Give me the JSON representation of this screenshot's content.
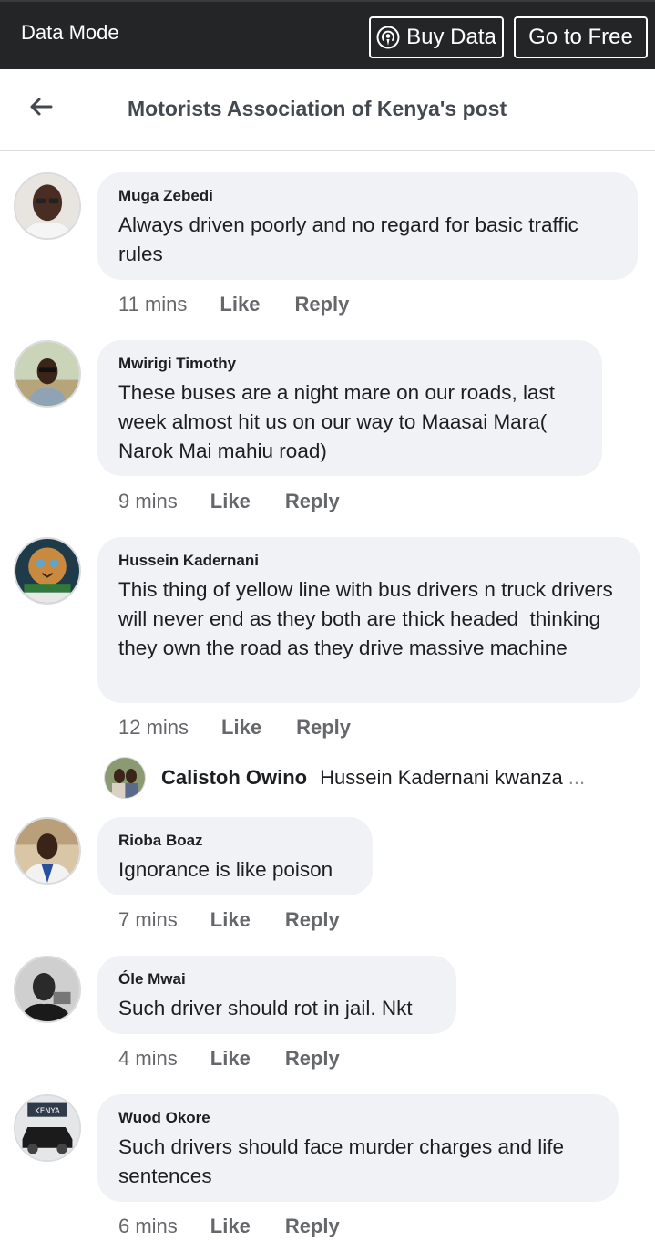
{
  "topbar": {
    "mode": "Data Mode",
    "buy_label": "Buy Data",
    "buy_icon": "podcast-icon",
    "free_label": "Go to Free"
  },
  "header": {
    "back_icon": "arrow-left-icon",
    "title": "Motorists Association of Kenya's post"
  },
  "comments": [
    {
      "author": "Muga Zebedi",
      "text": "Always driven poorly and no regard for basic traffic rules",
      "time": "11 mins",
      "like": "Like",
      "reply": "Reply"
    },
    {
      "author": "Mwirigi Timothy",
      "text": "These buses are a night mare on our roads, last week almost hit us on our way to Maasai Mara( Narok Mai mahiu road)",
      "time": "9 mins",
      "like": "Like",
      "reply": "Reply"
    },
    {
      "author": "Hussein Kadernani",
      "text": "This thing of yellow line with bus drivers n truck drivers will never end as they both are thick headed  thinking they own the road as they drive massive machine",
      "time": "12 mins",
      "like": "Like",
      "reply": "Reply"
    },
    {
      "author": "Rioba Boaz",
      "text": "Ignorance is like poison",
      "time": "7 mins",
      "like": "Like",
      "reply": "Reply"
    },
    {
      "author": "Óle Mwai",
      "text": "Such driver should rot in jail. Nkt",
      "time": "4 mins",
      "like": "Like",
      "reply": "Reply"
    },
    {
      "author": "Wuod Okore",
      "text": "Such drivers should face murder charges and life sentences",
      "time": "6 mins",
      "like": "Like",
      "reply": "Reply"
    }
  ],
  "reply_preview": {
    "author": "Calistoh Owino",
    "text": "Hussein Kadernani kwanza",
    "ellipsis": "..."
  },
  "avatar_badge_text": "KENYA"
}
